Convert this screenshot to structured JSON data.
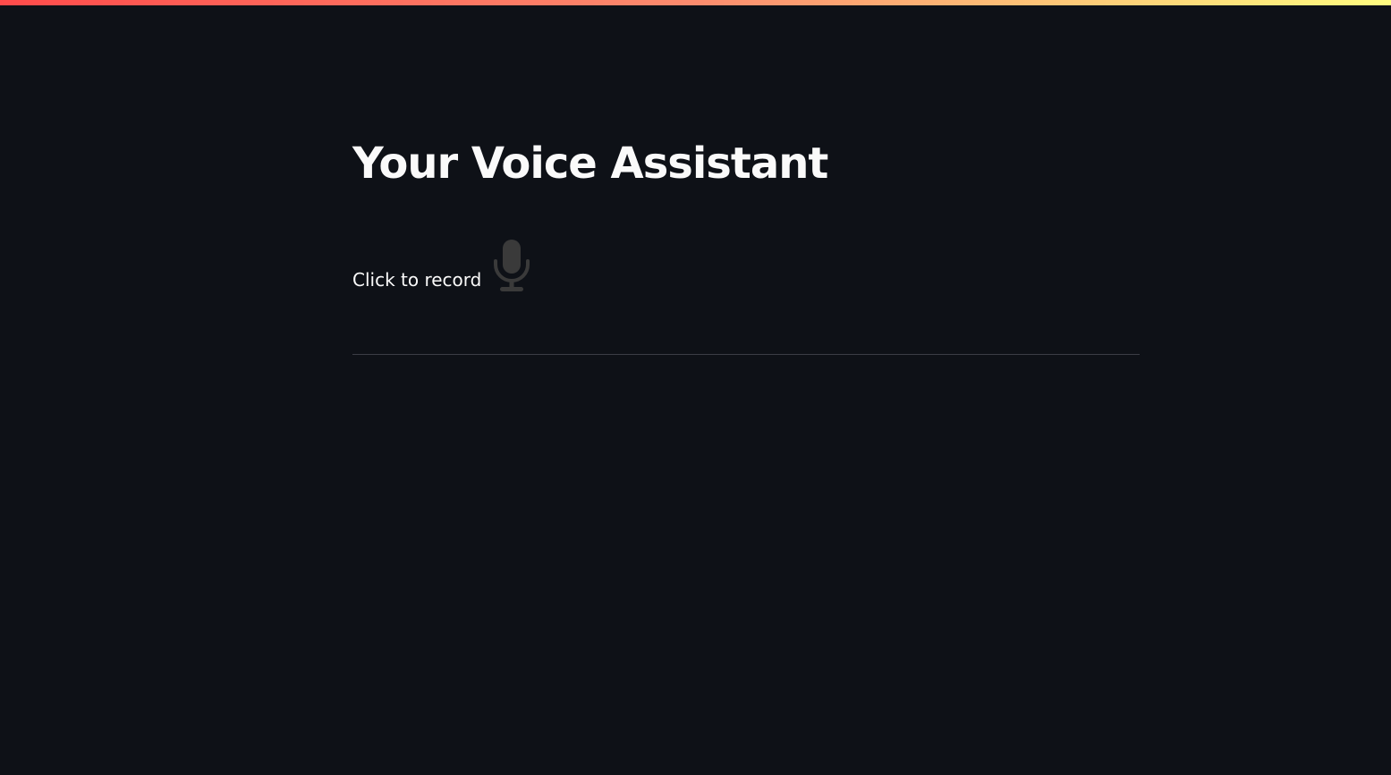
{
  "app": {
    "title": "Your Voice Assistant"
  },
  "recorder": {
    "label": "Click to record",
    "icon": "microphone-icon",
    "icon_color": "#3a3a3a"
  },
  "colors": {
    "background": "#0e1117",
    "text": "#fafafa",
    "accent_gradient": [
      "#ff4b4b",
      "#fc8c6e",
      "#fffd80"
    ],
    "divider": "#3b3d45"
  }
}
